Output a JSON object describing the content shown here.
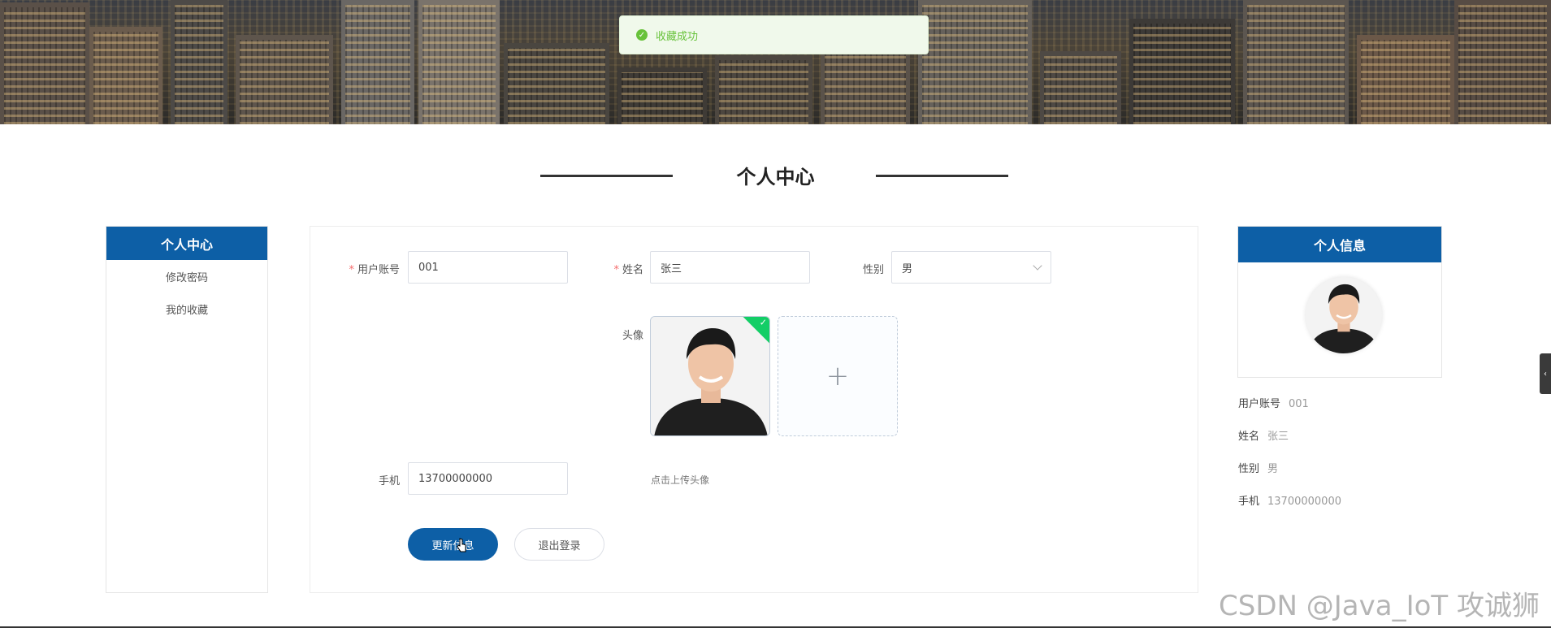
{
  "toast": {
    "message": "收藏成功",
    "icon": "check-circle-icon"
  },
  "section": {
    "title": "个人中心"
  },
  "sidebar": {
    "title": "个人中心",
    "items": [
      {
        "label": "修改密码"
      },
      {
        "label": "我的收藏"
      }
    ]
  },
  "form": {
    "account": {
      "label": "用户账号",
      "required_mark": "*",
      "value": "001"
    },
    "name": {
      "label": "姓名",
      "required_mark": "*",
      "value": "张三"
    },
    "gender": {
      "label": "性别",
      "value": "男"
    },
    "avatar": {
      "label": "头像",
      "hint": "点击上传头像"
    },
    "phone": {
      "label": "手机",
      "value": "13700000000"
    },
    "update_button": "更新信息",
    "logout_button": "退出登录"
  },
  "info_panel": {
    "title": "个人信息",
    "rows": [
      {
        "key": "用户账号",
        "value": "001"
      },
      {
        "key": "姓名",
        "value": "张三"
      },
      {
        "key": "性别",
        "value": "男"
      },
      {
        "key": "手机",
        "value": "13700000000"
      }
    ]
  },
  "edge_tab": {
    "glyph": "‹"
  },
  "watermark": "CSDN @Java_IoT 攻诚狮",
  "colors": {
    "primary": "#0d5fa6",
    "success": "#67c23a",
    "required": "#f56c6c"
  }
}
